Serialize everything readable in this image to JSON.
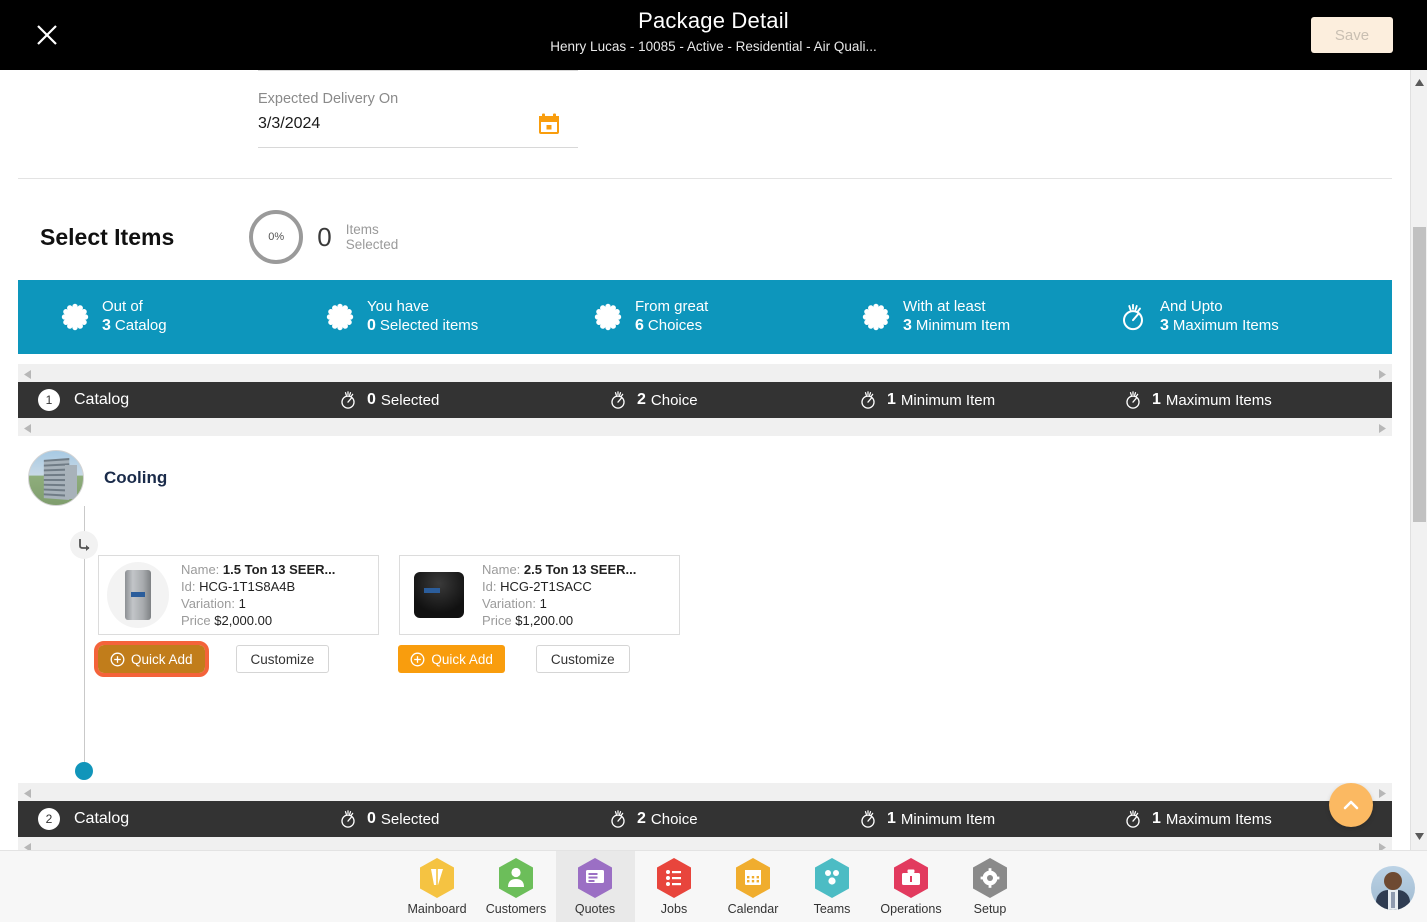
{
  "header": {
    "title": "Package Detail",
    "subtitle": "Henry Lucas - 10085 - Active - Residential - Air Quali...",
    "close_icon": "close-icon",
    "save_label": "Save",
    "save_color": "#fceedd"
  },
  "delivery": {
    "label": "Expected Delivery On",
    "value": "3/3/2024",
    "calendar_icon": "calendar-icon",
    "calendar_color": "#f99d0d"
  },
  "select_items": {
    "title": "Select Items",
    "progress_text": "0%",
    "progress_percent": 0,
    "count": "0",
    "count_label_line1": "Items",
    "count_label_line2": "Selected"
  },
  "summary_bar": {
    "background": "#0d96bc",
    "cells": [
      {
        "icon": "asterisk-icon",
        "top": "Out of",
        "value": "3",
        "unit": "Catalog"
      },
      {
        "icon": "asterisk-icon",
        "top": "You have",
        "value": "0",
        "unit": "Selected items"
      },
      {
        "icon": "asterisk-icon",
        "top": "From great",
        "value": "6",
        "unit": "Choices"
      },
      {
        "icon": "asterisk-icon",
        "top": "With at least",
        "value": "3",
        "unit": "Minimum Item"
      },
      {
        "icon": "stopwatch-icon",
        "top": "And Upto",
        "value": "3",
        "unit": "Maximum Items"
      }
    ]
  },
  "catalogs": [
    {
      "number": "1",
      "label": "Catalog",
      "cells": [
        {
          "icon": "stopwatch-icon",
          "value": "0",
          "unit": "Selected"
        },
        {
          "icon": "stopwatch-icon",
          "value": "2",
          "unit": "Choice"
        },
        {
          "icon": "stopwatch-icon",
          "value": "1",
          "unit": "Minimum Item"
        },
        {
          "icon": "stopwatch-icon",
          "value": "1",
          "unit": "Maximum Items"
        }
      ]
    },
    {
      "number": "2",
      "label": "Catalog",
      "cells": [
        {
          "icon": "stopwatch-icon",
          "value": "0",
          "unit": "Selected"
        },
        {
          "icon": "stopwatch-icon",
          "value": "2",
          "unit": "Choice"
        },
        {
          "icon": "stopwatch-icon",
          "value": "1",
          "unit": "Minimum Item"
        },
        {
          "icon": "stopwatch-icon",
          "value": "1",
          "unit": "Maximum Items"
        }
      ]
    }
  ],
  "group": {
    "title": "Cooling",
    "avatar_icon": "building-photo",
    "timeline_icon": "branch-arrow-icon",
    "field_labels": {
      "name": "Name:",
      "id": "Id:",
      "variation": "Variation:",
      "price": "Price"
    },
    "products": [
      {
        "name": "1.5 Ton 13 SEER...",
        "id": "HCG-1T1S8A4B",
        "variation": "1",
        "price": "$2,000.00",
        "image": "gray-ac-unit",
        "quick_add_label": "Quick Add",
        "customize_label": "Customize",
        "quick_add_focused": true
      },
      {
        "name": "2.5 Ton 13 SEER...",
        "id": "HCG-2T1SACC",
        "variation": "1",
        "price": "$1,200.00",
        "image": "black-ac-unit",
        "quick_add_label": "Quick Add",
        "customize_label": "Customize",
        "quick_add_focused": false
      }
    ]
  },
  "fab": {
    "icon": "chevron-up-icon",
    "color": "#fbb962"
  },
  "bottom_nav": {
    "items": [
      {
        "label": "Mainboard",
        "icon": "mainboard-icon",
        "color": "#f5c342",
        "active": false
      },
      {
        "label": "Customers",
        "icon": "person-icon",
        "color": "#6cbe5a",
        "active": false
      },
      {
        "label": "Quotes",
        "icon": "quotes-icon",
        "color": "#9b6fc4",
        "active": true
      },
      {
        "label": "Jobs",
        "icon": "list-icon",
        "color": "#e8453c",
        "active": false
      },
      {
        "label": "Calendar",
        "icon": "calendar-icon",
        "color": "#f0ad2e",
        "active": false
      },
      {
        "label": "Teams",
        "icon": "teams-icon",
        "color": "#4cbcc4",
        "active": false
      },
      {
        "label": "Operations",
        "icon": "briefcase-icon",
        "color": "#e23a5e",
        "active": false
      },
      {
        "label": "Setup",
        "icon": "gear-icon",
        "color": "#8a8a8a",
        "active": false
      }
    ],
    "avatar": "user-avatar"
  }
}
